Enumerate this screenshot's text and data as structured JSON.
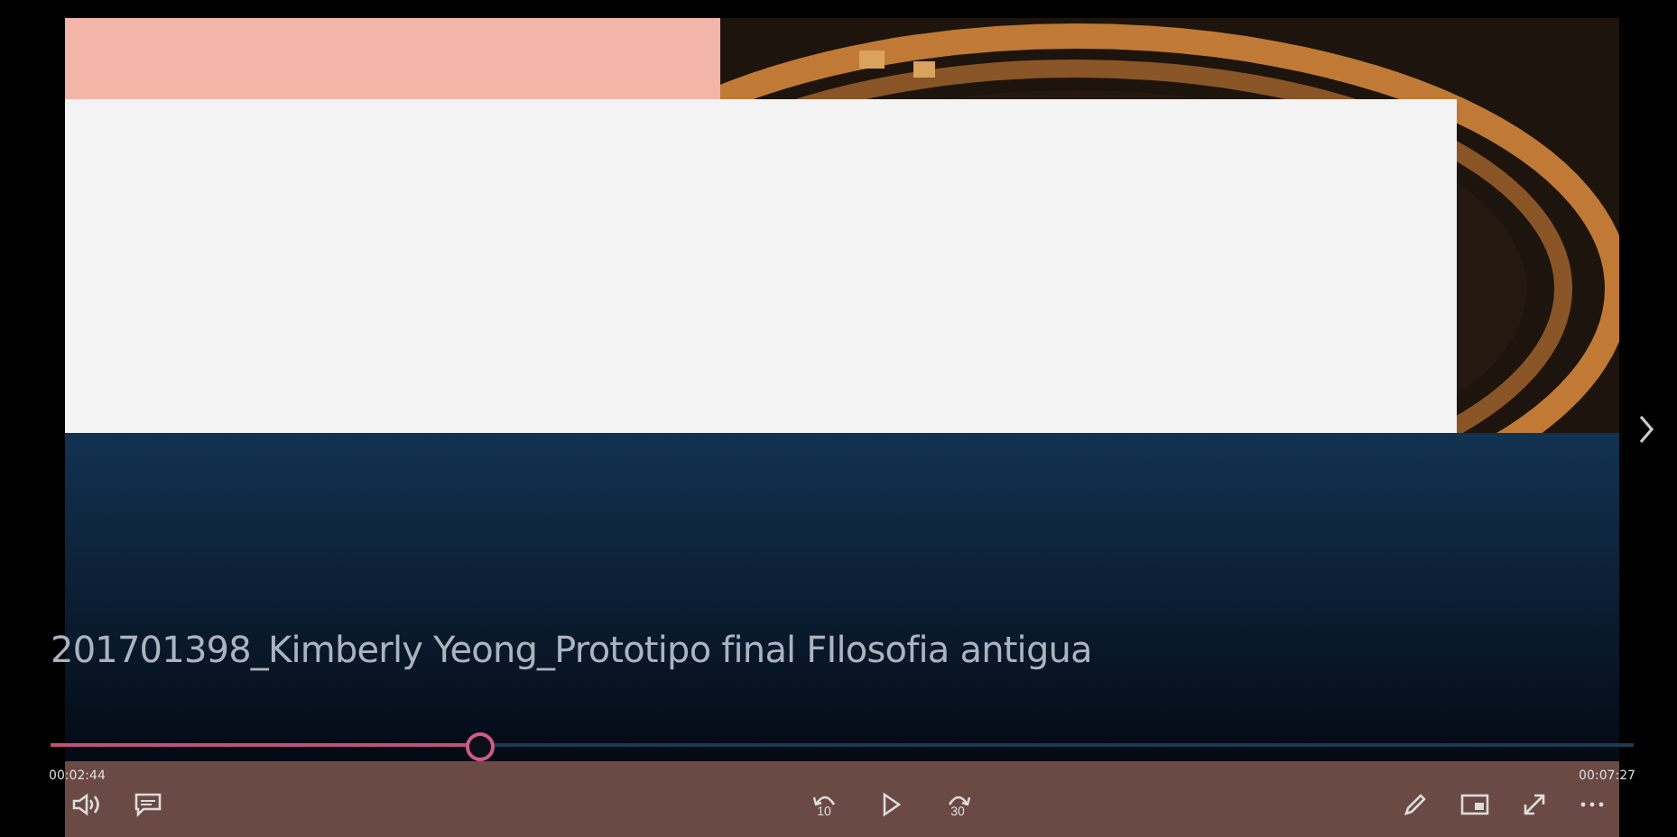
{
  "video": {
    "title": "201701398_Kimberly Yeong_Prototipo final FIlosofia antigua"
  },
  "playback": {
    "level": 0.27,
    "current_time": "00:02:44",
    "total_time": "00:07:27",
    "playing": false
  },
  "controls": {
    "rewind_seconds": "10",
    "forward_seconds": "30"
  }
}
